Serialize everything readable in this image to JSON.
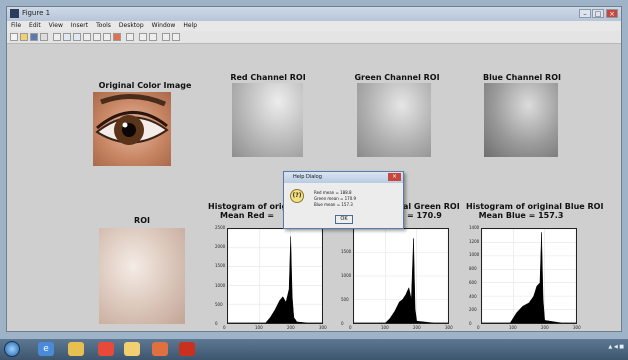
{
  "window": {
    "title": "Figure 1",
    "menu": [
      "File",
      "Edit",
      "View",
      "Insert",
      "Tools",
      "Desktop",
      "Window",
      "Help"
    ]
  },
  "axes": {
    "original_title": "Original Color Image",
    "red_roi_title": "Red Channel ROI",
    "green_roi_title": "Green Channel ROI",
    "blue_roi_title": "Blue Channel ROI",
    "roi_title": "ROI",
    "hist_red_title_1": "Histogram of original",
    "hist_red_title_2": "Mean Red = ",
    "hist_green_title_1": "al Green ROI",
    "hist_green_title_2": "= 170.9",
    "hist_blue_title_1": "Histogram of original Blue ROI",
    "hist_blue_title_2": "Mean Blue = 157.3"
  },
  "dialog": {
    "title": "Help Dialog",
    "icon_text": "(?)",
    "lines": [
      "Red mean = 188.8",
      "Green mean = 170.9",
      "Blue mean = 157.3"
    ],
    "ok_label": "OK"
  },
  "chart_data": [
    {
      "type": "area",
      "title": "Histogram of original Red ROI",
      "xlim": [
        0,
        300
      ],
      "ylim": [
        0,
        2500
      ],
      "xticks": [
        "0",
        "100",
        "200",
        "300"
      ],
      "yticks": [
        "0",
        "500",
        "1000",
        "1500",
        "2000",
        "2500"
      ],
      "x": [
        0,
        120,
        135,
        150,
        165,
        175,
        185,
        195,
        200,
        205,
        210,
        220,
        255,
        300
      ],
      "values": [
        0,
        0,
        150,
        350,
        600,
        700,
        550,
        900,
        2300,
        700,
        150,
        30,
        0,
        0
      ]
    },
    {
      "type": "area",
      "title": "Histogram of original Green ROI",
      "xlim": [
        0,
        300
      ],
      "ylim": [
        0,
        2000
      ],
      "xticks": [
        "0",
        "100",
        "200",
        "300"
      ],
      "yticks": [
        "0",
        "500",
        "1000",
        "1500",
        "2000"
      ],
      "x": [
        0,
        100,
        115,
        130,
        145,
        155,
        165,
        175,
        183,
        190,
        195,
        200,
        255,
        300
      ],
      "values": [
        0,
        0,
        100,
        250,
        450,
        500,
        600,
        750,
        500,
        1800,
        300,
        40,
        0,
        0
      ]
    },
    {
      "type": "area",
      "title": "Histogram of original Blue ROI",
      "xlim": [
        0,
        300
      ],
      "ylim": [
        0,
        1400
      ],
      "xticks": [
        "0",
        "100",
        "200",
        "300"
      ],
      "yticks": [
        "0",
        "200",
        "400",
        "600",
        "800",
        "1000",
        "1200",
        "1400"
      ],
      "x": [
        0,
        90,
        110,
        130,
        150,
        165,
        175,
        185,
        190,
        195,
        200,
        255,
        300
      ],
      "values": [
        0,
        0,
        150,
        250,
        300,
        400,
        550,
        600,
        1350,
        350,
        40,
        0,
        0
      ]
    }
  ],
  "taskbar": {
    "apps": [
      "ie-icon",
      "folder-icon",
      "media-icon",
      "chrome-icon",
      "explorer-icon",
      "matlab-icon",
      "acrobat-icon"
    ]
  }
}
